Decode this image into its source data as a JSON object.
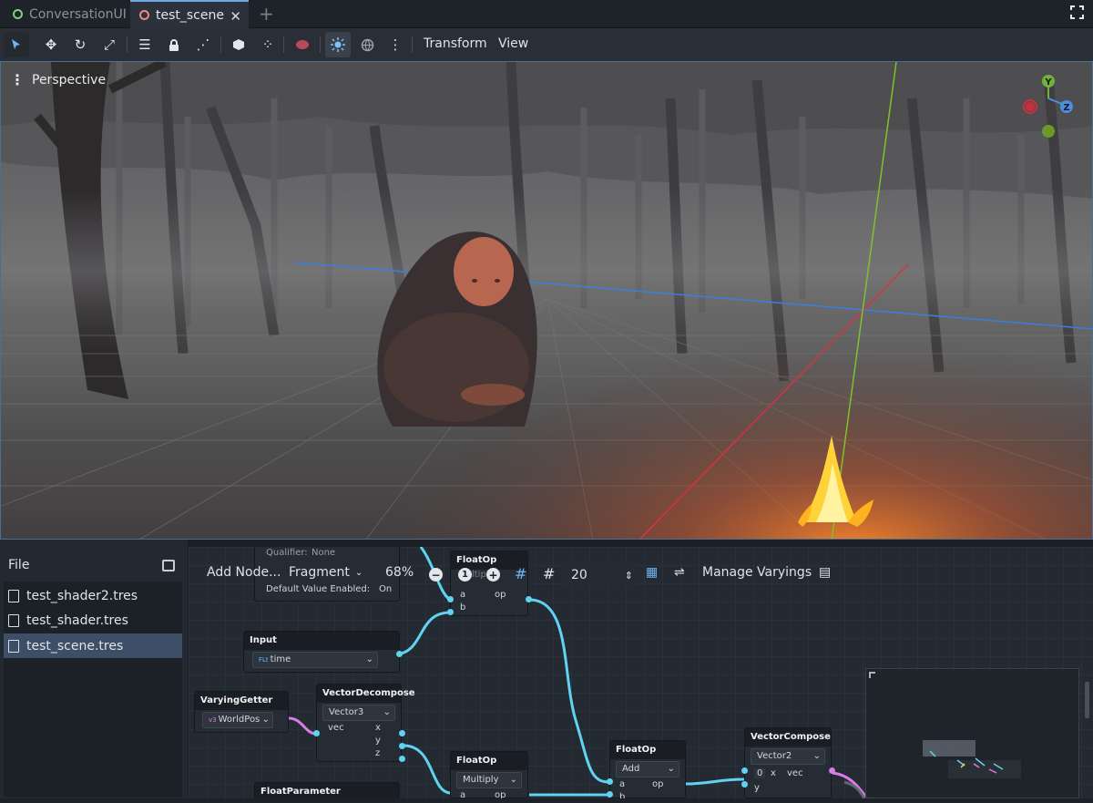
{
  "tabs": [
    {
      "label": "ConversationUI"
    },
    {
      "label": "test_scene"
    }
  ],
  "toolbar": {
    "transform_label": "Transform",
    "view_label": "View"
  },
  "viewport": {
    "perspective_label": "Perspective",
    "gizmo": {
      "y": "Y",
      "z": "Z"
    }
  },
  "file_panel": {
    "title": "File",
    "files": [
      "test_shader2.tres",
      "test_shader.tres",
      "test_scene.tres"
    ],
    "selected_index": 2
  },
  "graph_toolbar": {
    "add_node": "Add Node...",
    "mode": "Fragment",
    "zoom": "68%",
    "snap": "20",
    "manage_varyings": "Manage Varyings"
  },
  "nodes": {
    "partial_top": {
      "qualifier_label": "Qualifier:",
      "qualifier_value": "None",
      "default_label": "Default Value Enabled:",
      "default_value": "On"
    },
    "floatop_top": {
      "title": "FloatOp",
      "op": "Multiply",
      "port_a": "a",
      "port_b": "b",
      "port_op": "op"
    },
    "input": {
      "title": "Input",
      "value": "time",
      "type_tag": "FLt"
    },
    "varying_getter": {
      "title": "VaryingGetter",
      "value": "WorldPos",
      "type_tag": "v3"
    },
    "vector_decompose": {
      "title": "VectorDecompose",
      "type": "Vector3",
      "port_vec": "vec",
      "port_x": "x",
      "port_y": "y",
      "port_z": "z"
    },
    "floatop_mid": {
      "title": "FloatOp",
      "op": "Multiply",
      "port_a": "a",
      "port_op": "op"
    },
    "floatop_add": {
      "title": "FloatOp",
      "op": "Add",
      "port_a": "a",
      "port_b": "b",
      "port_op": "op"
    },
    "vector_compose": {
      "title": "VectorCompose",
      "type": "Vector2",
      "x_value": "0",
      "port_x": "x",
      "port_y": "y",
      "port_vec": "vec"
    },
    "float_parameter": {
      "title": "FloatParameter"
    }
  },
  "colors": {
    "accent": "#5fd3f0",
    "selection": "#3c4f66",
    "varying_wire": "#d87be8"
  }
}
